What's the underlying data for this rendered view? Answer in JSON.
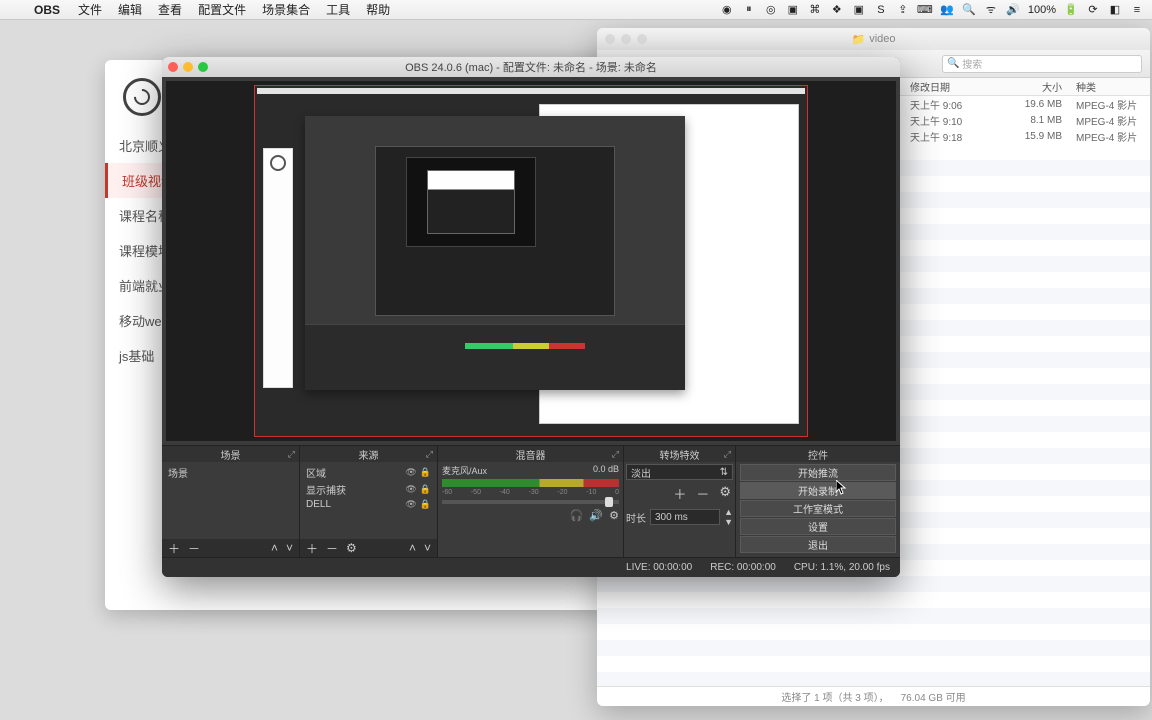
{
  "menubar": {
    "app": "OBS",
    "items": [
      "文件",
      "编辑",
      "查看",
      "配置文件",
      "场景集合",
      "工具",
      "帮助"
    ],
    "battery": "100%",
    "extra": "◧"
  },
  "finder": {
    "title": "video",
    "search_placeholder": "搜索",
    "headers": {
      "date": "修改日期",
      "size": "大小",
      "kind": "种类"
    },
    "rows": [
      {
        "date": "天上午 9:06",
        "size": "19.6 MB",
        "kind": "MPEG-4 影片"
      },
      {
        "date": "天上午 9:10",
        "size": "8.1 MB",
        "kind": "MPEG-4 影片"
      },
      {
        "date": "天上午 9:18",
        "size": "15.9 MB",
        "kind": "MPEG-4 影片"
      }
    ],
    "status_left": "选择了 1 项（共 3 项），",
    "status_right": "76.04 GB 可用"
  },
  "bgwin": {
    "items": [
      {
        "label": "北京顺义"
      },
      {
        "label": "班级视频",
        "sel": true
      },
      {
        "label": "课程名称："
      },
      {
        "label": "课程模块"
      },
      {
        "label": "前端就业"
      },
      {
        "label": "移动web"
      },
      {
        "label": "js基础"
      }
    ]
  },
  "obs": {
    "title": "OBS 24.0.6 (mac) - 配置文件: 未命名 - 场景: 未命名",
    "panels": {
      "scenes": {
        "title": "场景",
        "items": [
          "场景"
        ]
      },
      "sources": {
        "title": "来源",
        "items": [
          "区域",
          "显示捕获",
          "DELL"
        ]
      },
      "mixer": {
        "title": "混音器",
        "channel": "麦克风/Aux",
        "db": "0.0 dB"
      },
      "transitions": {
        "title": "转场特效",
        "selected": "淡出",
        "duration_label": "时长",
        "duration_value": "300 ms"
      },
      "controls": {
        "title": "控件",
        "buttons": [
          "开始推流",
          "开始录制",
          "工作室模式",
          "设置",
          "退出"
        ]
      }
    },
    "status": {
      "live": "LIVE: 00:00:00",
      "rec": "REC: 00:00:00",
      "cpu": "CPU: 1.1%, 20.00 fps"
    }
  }
}
